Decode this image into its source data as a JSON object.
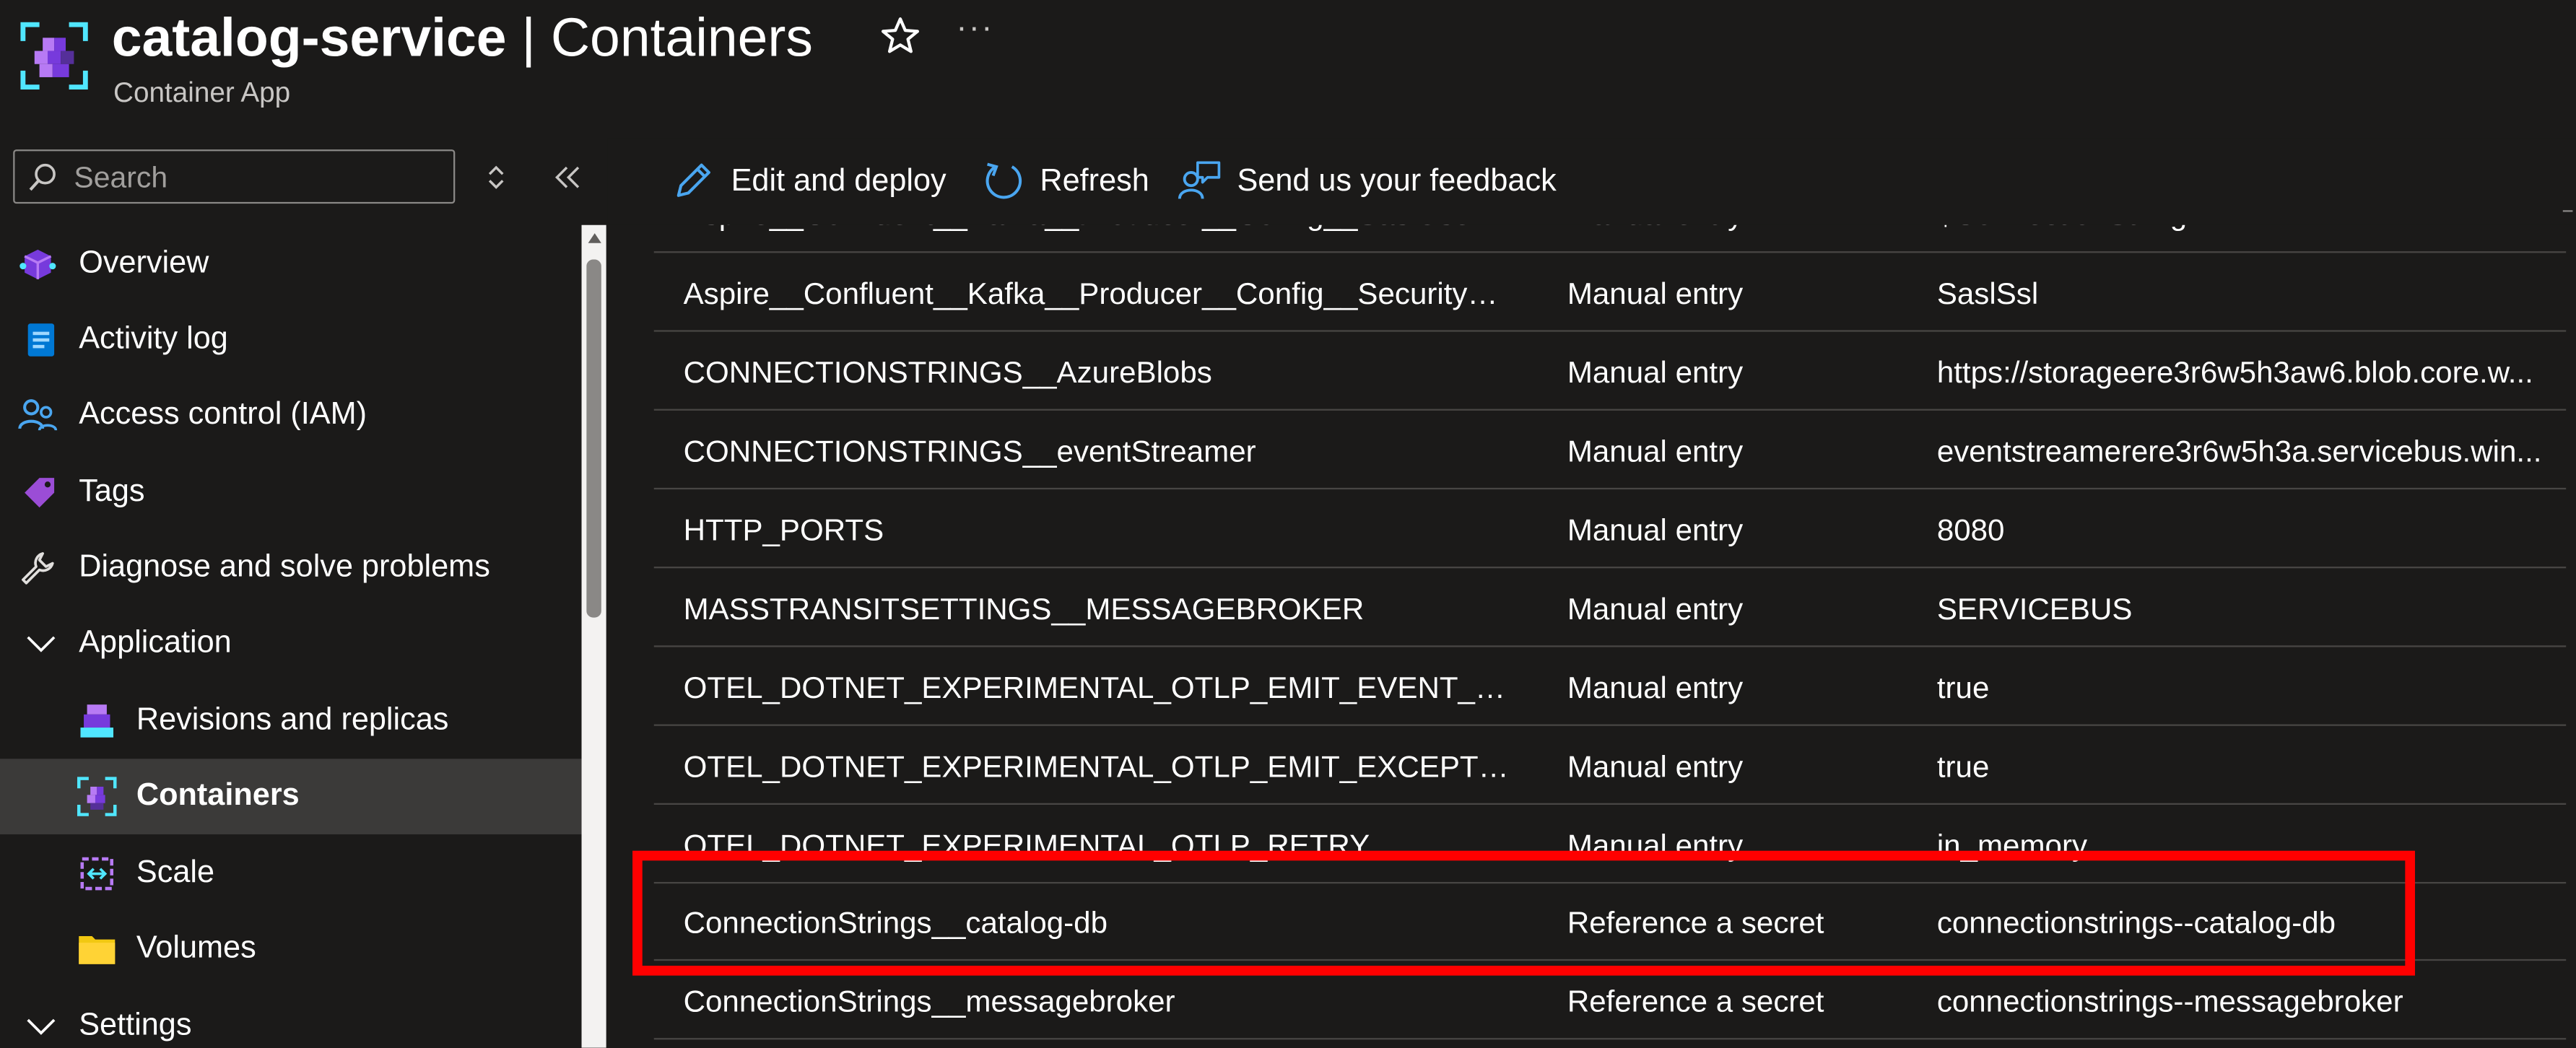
{
  "header": {
    "resource_name": "catalog-service",
    "separator": " | ",
    "page_name": "Containers",
    "subtitle": "Container App",
    "more": "···"
  },
  "sidebar": {
    "search_placeholder": "Search",
    "items": [
      {
        "label": "Overview"
      },
      {
        "label": "Activity log"
      },
      {
        "label": "Access control (IAM)"
      },
      {
        "label": "Tags"
      },
      {
        "label": "Diagnose and solve problems"
      },
      {
        "label": "Application"
      },
      {
        "label": "Revisions and replicas"
      },
      {
        "label": "Containers"
      },
      {
        "label": "Scale"
      },
      {
        "label": "Volumes"
      },
      {
        "label": "Settings"
      }
    ]
  },
  "toolbar": {
    "edit_label": "Edit and deploy",
    "refresh_label": "Refresh",
    "feedback_label": "Send us your feedback"
  },
  "table": {
    "rows": [
      {
        "name": "Aspire__Confluent__Kafka__Producer__Config__SaslUsername",
        "source": "Manual entry",
        "value": "$ConnectionString"
      },
      {
        "name": "Aspire__Confluent__Kafka__Producer__Config__SecurityProt...",
        "source": "Manual entry",
        "value": "SaslSsl"
      },
      {
        "name": "CONNECTIONSTRINGS__AzureBlobs",
        "source": "Manual entry",
        "value": "https://storageere3r6w5h3aw6.blob.core.w..."
      },
      {
        "name": "CONNECTIONSTRINGS__eventStreamer",
        "source": "Manual entry",
        "value": "eventstreamerere3r6w5h3a.servicebus.win..."
      },
      {
        "name": "HTTP_PORTS",
        "source": "Manual entry",
        "value": "8080"
      },
      {
        "name": "MASSTRANSITSETTINGS__MESSAGEBROKER",
        "source": "Manual entry",
        "value": "SERVICEBUS"
      },
      {
        "name": "OTEL_DOTNET_EXPERIMENTAL_OTLP_EMIT_EVENT_LOG_AT...",
        "source": "Manual entry",
        "value": "true"
      },
      {
        "name": "OTEL_DOTNET_EXPERIMENTAL_OTLP_EMIT_EXCEPTION_LO...",
        "source": "Manual entry",
        "value": "true"
      },
      {
        "name": "OTEL_DOTNET_EXPERIMENTAL_OTLP_RETRY",
        "source": "Manual entry",
        "value": "in_memory"
      },
      {
        "name": "ConnectionStrings__catalog-db",
        "source": "Reference a secret",
        "value": "connectionstrings--catalog-db"
      },
      {
        "name": "ConnectionStrings__messagebroker",
        "source": "Reference a secret",
        "value": "connectionstrings--messagebroker"
      }
    ]
  },
  "colors": {
    "background": "#1b1a19",
    "accent": "#0078d4",
    "highlight": "#ff0000",
    "active_nav": "#3b3a39"
  }
}
